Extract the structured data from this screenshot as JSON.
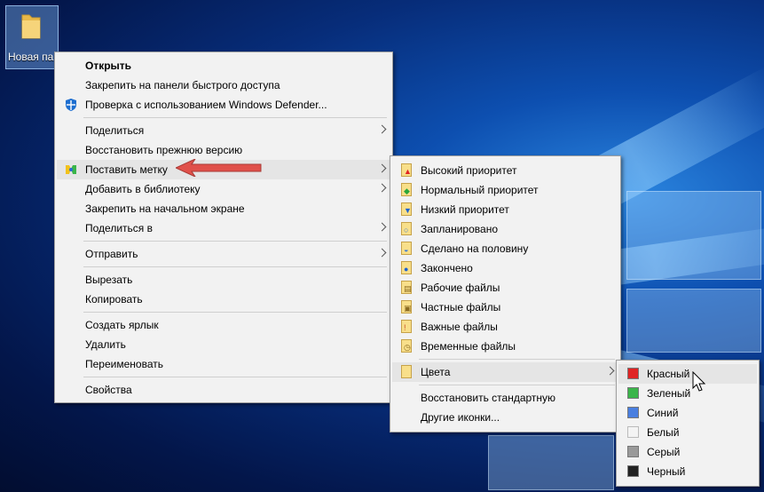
{
  "desktop": {
    "icon_label": "Новая па"
  },
  "main_menu": {
    "items": [
      {
        "label": "Открыть"
      },
      {
        "label": "Закрепить на панели быстрого доступа"
      },
      {
        "label": "Проверка с использованием Windows Defender..."
      },
      {
        "label": "Поделиться"
      },
      {
        "label": "Восстановить прежнюю версию"
      },
      {
        "label": "Поставить метку"
      },
      {
        "label": "Добавить в библиотеку"
      },
      {
        "label": "Закрепить на начальном экране"
      },
      {
        "label": "Поделиться в"
      },
      {
        "label": "Отправить"
      },
      {
        "label": "Вырезать"
      },
      {
        "label": "Копировать"
      },
      {
        "label": "Создать ярлык"
      },
      {
        "label": "Удалить"
      },
      {
        "label": "Переименовать"
      },
      {
        "label": "Свойства"
      }
    ]
  },
  "tag_menu": {
    "items": [
      {
        "label": "Высокий приоритет",
        "icon": "high-priority-icon"
      },
      {
        "label": "Нормальный приоритет",
        "icon": "normal-priority-icon"
      },
      {
        "label": "Низкий приоритет",
        "icon": "low-priority-icon"
      },
      {
        "label": "Запланировано",
        "icon": "planned-icon"
      },
      {
        "label": "Сделано на половину",
        "icon": "half-done-icon"
      },
      {
        "label": "Закончено",
        "icon": "finished-icon"
      },
      {
        "label": "Рабочие файлы",
        "icon": "work-files-icon"
      },
      {
        "label": "Частные файлы",
        "icon": "private-files-icon"
      },
      {
        "label": "Важные файлы",
        "icon": "important-files-icon"
      },
      {
        "label": "Временные файлы",
        "icon": "temp-files-icon"
      },
      {
        "label": "Цвета",
        "icon": "colors-icon"
      },
      {
        "label": "Восстановить стандартную"
      },
      {
        "label": "Другие иконки..."
      }
    ]
  },
  "color_menu": {
    "items": [
      {
        "label": "Красный",
        "color": "#e02424"
      },
      {
        "label": "Зеленый",
        "color": "#3bb54a"
      },
      {
        "label": "Синий",
        "color": "#4a7fe0"
      },
      {
        "label": "Белый",
        "color": "#f4f4f4"
      },
      {
        "label": "Серый",
        "color": "#9a9a9a"
      },
      {
        "label": "Черный",
        "color": "#222222"
      }
    ]
  },
  "colors": {
    "menu_bg": "#f2f2f2",
    "highlight": "#e5e5e5",
    "annotation_arrow": "#e0504a"
  }
}
